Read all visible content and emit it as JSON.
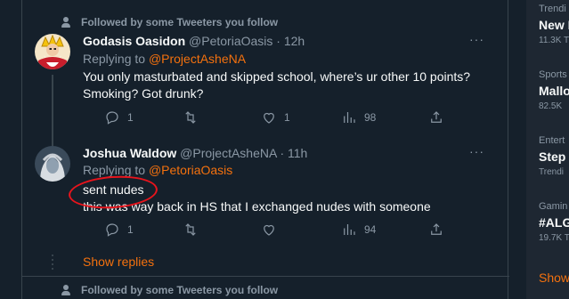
{
  "tweets": [
    {
      "social_context": "Followed by some Tweeters you follow",
      "name": "Godasis Oasidon",
      "handle": "@PetoriaOasis",
      "sep": "·",
      "time": "12h",
      "replying_prefix": "Replying to",
      "replying_handle": "@ProjectAsheNA",
      "lines": [
        "You only masturbated and skipped school, where’s ur other 10 points?",
        "Smoking? Got drunk?"
      ],
      "replies": "1",
      "retweets": "",
      "likes": "1",
      "views": "98"
    },
    {
      "name": "Joshua Waldow",
      "handle": "@ProjectAsheNA",
      "sep": "·",
      "time": "11h",
      "replying_prefix": "Replying to",
      "replying_handle": "@PetoriaOasis",
      "lines": [
        "sent nudes",
        "this was way back in HS that I exchanged nudes with someone"
      ],
      "replies": "1",
      "retweets": "",
      "likes": "",
      "views": "94"
    }
  ],
  "show_replies": "Show replies",
  "bottom_social_context": "Followed by some Tweeters you follow",
  "more_label": "···",
  "trends": [
    {
      "category": "Trendi",
      "title": "New I",
      "count": "11.3K T"
    },
    {
      "category": "Sports",
      "title": "Mallo",
      "count": "82.5K"
    },
    {
      "category": "Entert",
      "title": "Step",
      "count": "Trendi"
    },
    {
      "category": "Gamin",
      "title": "#ALG",
      "count": "19.7K T"
    }
  ],
  "sidebar_show": "Show",
  "colors": {
    "accent": "#f4710e",
    "background": "#15202b",
    "annotation": "#e8141c"
  }
}
